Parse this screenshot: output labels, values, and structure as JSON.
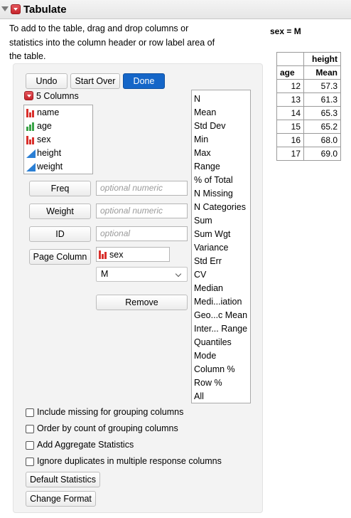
{
  "window": {
    "title": "Tabulate"
  },
  "instructions": "To add to the table, drag and drop columns or statistics into the column header or row label area of the table.",
  "by_group": "sex = M",
  "toolbar": {
    "undo": "Undo",
    "start_over": "Start Over",
    "done": "Done"
  },
  "columns_header": "5 Columns",
  "columns": [
    {
      "name": "name",
      "type": "nominal-icon"
    },
    {
      "name": "age",
      "type": "ordinal-icon"
    },
    {
      "name": "sex",
      "type": "nominal-icon"
    },
    {
      "name": "height",
      "type": "continuous-icon"
    },
    {
      "name": "weight",
      "type": "continuous-icon"
    }
  ],
  "roles": {
    "freq": {
      "label": "Freq",
      "placeholder": "optional numeric"
    },
    "weight": {
      "label": "Weight",
      "placeholder": "optional numeric"
    },
    "id": {
      "label": "ID",
      "placeholder": "optional"
    },
    "page": {
      "label": "Page Column",
      "value": "sex"
    }
  },
  "page_level": "M",
  "remove_label": "Remove",
  "statistics": [
    "N",
    "Mean",
    "Std Dev",
    "Min",
    "Max",
    "Range",
    "% of Total",
    "N Missing",
    "N Categories",
    "Sum",
    "Sum Wgt",
    "Variance",
    "Std Err",
    "CV",
    "Median",
    "Medi...iation",
    "Geo...c Mean",
    "Inter... Range",
    "Quantiles",
    "Mode",
    "Column %",
    "Row %",
    "All"
  ],
  "options": [
    "Include missing for grouping columns",
    "Order by count of grouping columns",
    "Add Aggregate Statistics",
    "Ignore duplicates in multiple response columns"
  ],
  "buttons": {
    "default_stats": "Default Statistics",
    "change_format": "Change Format"
  },
  "table": {
    "col_var": "height",
    "row_var": "age",
    "stat": "Mean",
    "rows": [
      {
        "age": "12",
        "mean": "57.3"
      },
      {
        "age": "13",
        "mean": "61.3"
      },
      {
        "age": "14",
        "mean": "65.3"
      },
      {
        "age": "15",
        "mean": "65.2"
      },
      {
        "age": "16",
        "mean": "68.0"
      },
      {
        "age": "17",
        "mean": "69.0"
      }
    ]
  },
  "colors": {
    "nominal": "#d9302c",
    "ordinal": "#3aa348",
    "continuous": "#2b7fd4",
    "primary": "#1566c8",
    "menu_red": "#c6252c"
  }
}
